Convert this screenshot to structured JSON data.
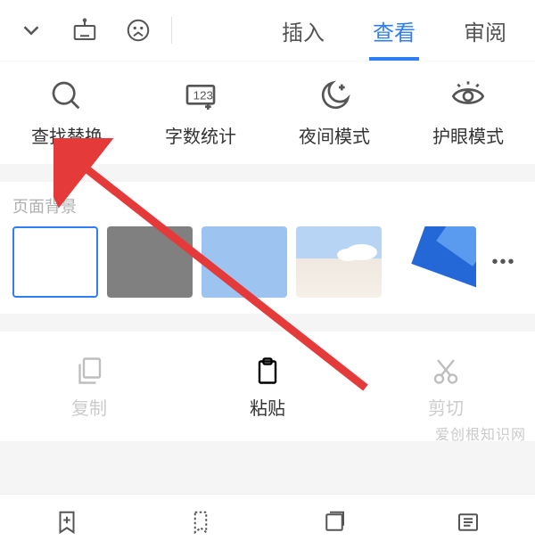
{
  "topbar": {
    "tabs": [
      {
        "label": "插入",
        "active": false
      },
      {
        "label": "查看",
        "active": true
      },
      {
        "label": "审阅",
        "active": false
      }
    ]
  },
  "functions": [
    {
      "id": "find-replace",
      "label": "查找替换",
      "icon": "search"
    },
    {
      "id": "word-count",
      "label": "字数统计",
      "icon": "wordcount"
    },
    {
      "id": "night-mode",
      "label": "夜间模式",
      "icon": "moon"
    },
    {
      "id": "eye-care",
      "label": "护眼模式",
      "icon": "eye"
    }
  ],
  "sections": {
    "bg_title": "页面背景"
  },
  "swatches": [
    {
      "id": "white",
      "selected": true
    },
    {
      "id": "gray"
    },
    {
      "id": "blue"
    },
    {
      "id": "clouds"
    },
    {
      "id": "pattern"
    }
  ],
  "more_label": "•••",
  "clipboard": [
    {
      "id": "copy",
      "label": "复制",
      "enabled": false
    },
    {
      "id": "paste",
      "label": "粘贴",
      "enabled": true
    },
    {
      "id": "cut",
      "label": "剪切",
      "enabled": false
    }
  ],
  "watermark": "爱创根知识网",
  "colors": {
    "accent": "#2f7ef3"
  }
}
